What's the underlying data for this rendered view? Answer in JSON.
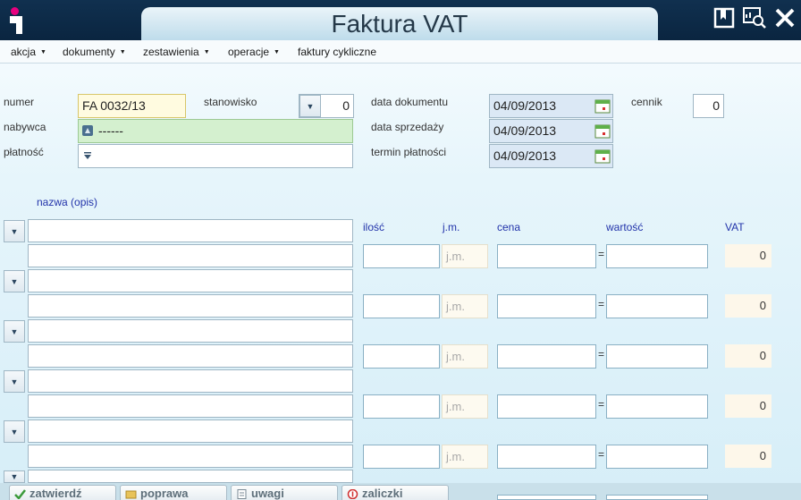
{
  "window": {
    "title": "Faktura VAT"
  },
  "menu": [
    {
      "label": "akcja"
    },
    {
      "label": "dokumenty"
    },
    {
      "label": "zestawienia"
    },
    {
      "label": "operacje"
    },
    {
      "label": "faktury cykliczne"
    }
  ],
  "header": {
    "numer_label": "numer",
    "numer_value": "FA 0032/13",
    "stanowisko_label": "stanowisko",
    "stanowisko_value": "0",
    "data_dokumentu_label": "data dokumentu",
    "data_dokumentu_value": "04/09/2013",
    "cennik_label": "cennik",
    "cennik_value": "0",
    "nabywca_label": "nabywca",
    "nabywca_value": "------",
    "data_sprzedazy_label": "data sprzedaży",
    "data_sprzedazy_value": "04/09/2013",
    "platnosc_label": "płatność",
    "termin_platnosci_label": "termin płatności",
    "termin_platnosci_value": "04/09/2013"
  },
  "items_header": {
    "nazwa": "nazwa (opis)",
    "ilosc": "ilość",
    "jm": "j.m.",
    "cena": "cena",
    "wartosc": "wartość",
    "vat": "VAT"
  },
  "items": [
    {
      "jm_placeholder": "j.m.",
      "vat": "0"
    },
    {
      "jm_placeholder": "j.m.",
      "vat": "0"
    },
    {
      "jm_placeholder": "j.m.",
      "vat": "0"
    },
    {
      "jm_placeholder": "j.m.",
      "vat": "0"
    },
    {
      "jm_placeholder": "j.m.",
      "vat": "0"
    }
  ],
  "buttons": {
    "zatwierdz": "zatwierdź",
    "poprawa": "poprawa",
    "uwagi": "uwagi",
    "zaliczki": "zaliczki"
  },
  "colors": {
    "titlebar": "#0a2540",
    "logo_accent": "#e6007e",
    "header_blue_text": "#2233aa"
  }
}
